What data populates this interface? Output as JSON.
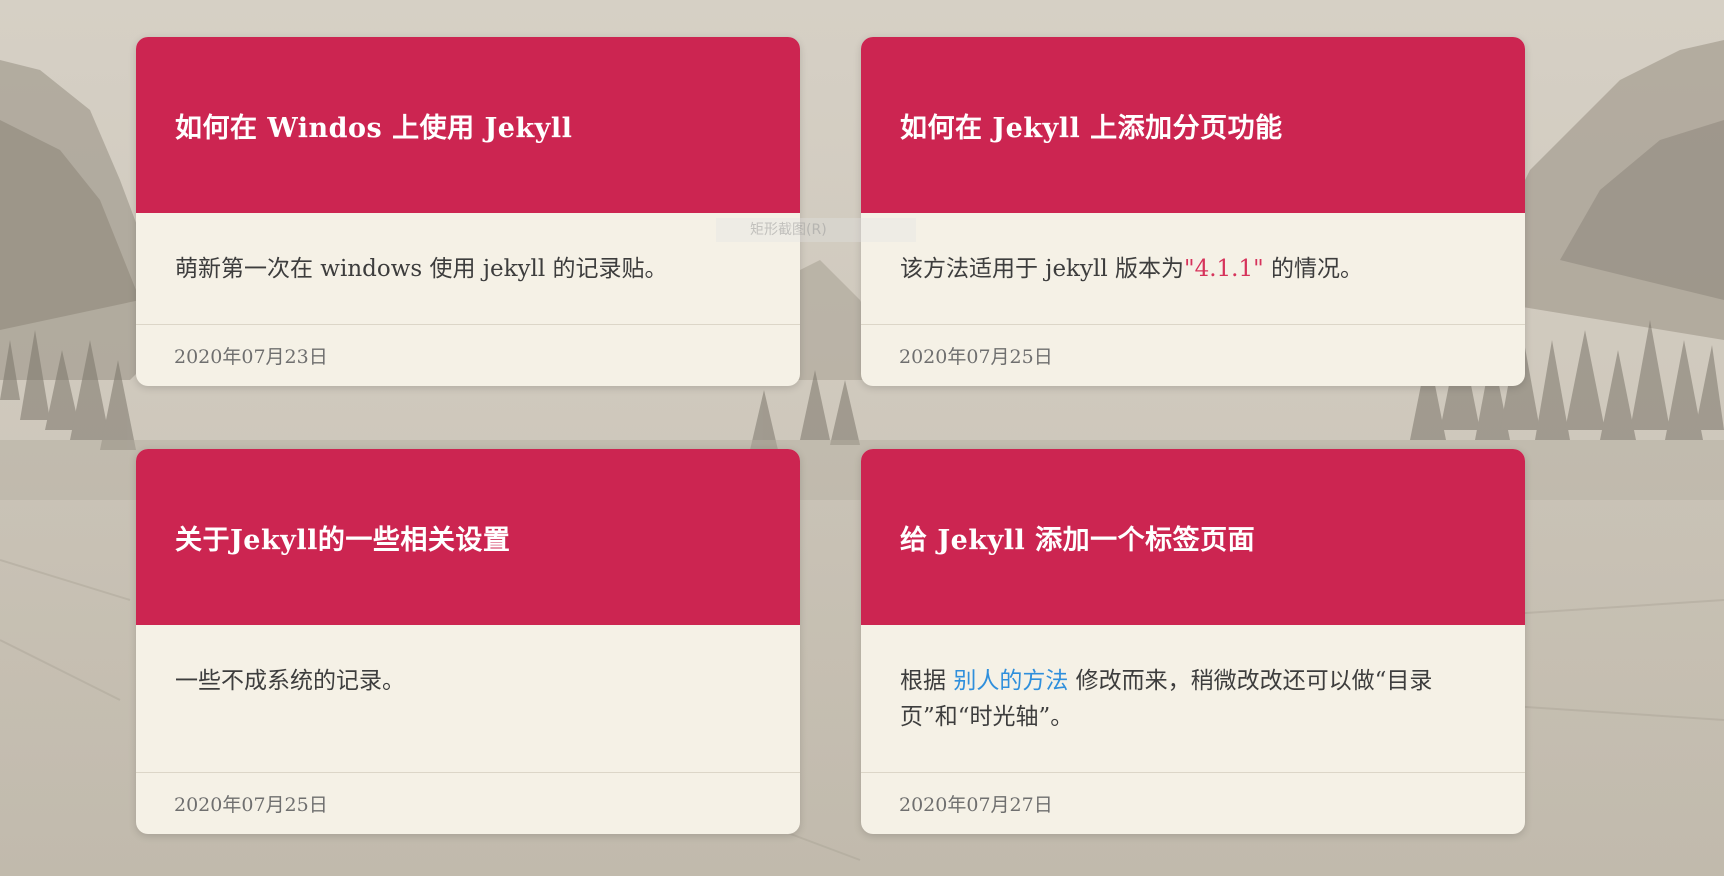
{
  "posts": [
    {
      "title": "如何在 Windos 上使用 Jekyll",
      "excerpt": "萌新第一次在 windows 使用 jekyll 的记录贴。",
      "date": "2020年07月23日"
    },
    {
      "title": "如何在 Jekyll 上添加分页功能",
      "excerpt_before": "该方法适用于 jekyll 版本为",
      "excerpt_code": "\"4.1.1\"",
      "excerpt_after": " 的情况。",
      "date": "2020年07月25日"
    },
    {
      "title": "关于Jekyll的一些相关设置",
      "excerpt": "一些不成系统的记录。",
      "date": "2020年07月25日"
    },
    {
      "title": "给 Jekyll 添加一个标签页面",
      "excerpt_before": "根据 ",
      "excerpt_link": "别人的方法",
      "excerpt_after": " 修改而来，稍微改改还可以做“目录页”和“时光轴”。",
      "date": "2020年07月27日"
    }
  ],
  "overlay": {
    "ghost_text": "矩形截图(R)"
  },
  "colors": {
    "header": "#cc2551",
    "card_body": "#f5f1e6",
    "link": "#2f8fdc",
    "code_string": "#d6335b"
  }
}
